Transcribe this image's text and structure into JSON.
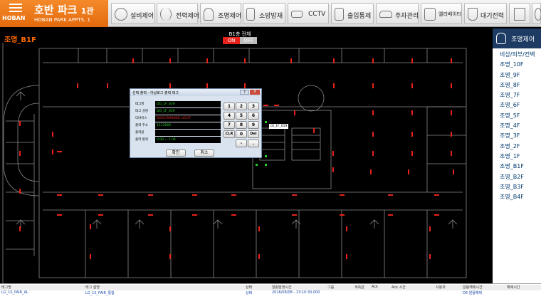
{
  "brand": {
    "logo_text": "HOBAN",
    "title": "호반 파크",
    "title_suffix": "1관",
    "subtitle": "HOBAN PARK APPTS. 1"
  },
  "nav": [
    {
      "label": "설비제어",
      "icon": "fan-icon"
    },
    {
      "label": "전력제어",
      "icon": "antenna-icon"
    },
    {
      "label": "조명제어",
      "icon": "lightbulb-icon"
    },
    {
      "label": "소방방재",
      "icon": "fire-extinguisher-icon"
    },
    {
      "label": "CCTV",
      "icon": "cctv-icon"
    },
    {
      "label": "출입통제",
      "icon": "door-icon"
    },
    {
      "label": "주차관리",
      "icon": "car-icon"
    },
    {
      "label": "엘리베이터",
      "icon": "elevator-icon"
    },
    {
      "label": "대기전력",
      "icon": "plug-icon"
    },
    {
      "label": "",
      "icon": "home-icon"
    },
    {
      "label": "",
      "icon": "settings-icon"
    }
  ],
  "main": {
    "floor_label": "조명_B1F",
    "all_switch": {
      "title": "B1층 전체",
      "on": "ON",
      "off": "OFF"
    }
  },
  "right_panel": {
    "title": "조명제어",
    "items": [
      "비상/외부/컨벡",
      "조명_10F",
      "조명_9F",
      "조명_8F",
      "조명_7F",
      "조명_6F",
      "조명_5F",
      "조명_4F",
      "조명_3F",
      "조명_2F",
      "조명_1F",
      "조명_B1F",
      "조명_B2F",
      "조명_B3F",
      "조명_B4F"
    ]
  },
  "dialog": {
    "title": "선택 출력 - 아날로그 출력 태그",
    "close": "X",
    "help": "?",
    "fields": [
      {
        "key": "태그명",
        "value": "DO_1F_019",
        "color": "green"
      },
      {
        "key": "태그 설명",
        "value": "DO_1F_019",
        "color": "green"
      },
      {
        "key": "디바이스",
        "value": "DOIG:PARKING LIGHT",
        "color": "red"
      },
      {
        "key": "출력 주소",
        "value": "1113003",
        "color": "green"
      },
      {
        "key": "출력값",
        "value": "",
        "color": "green"
      },
      {
        "key": "출력 범위",
        "value": "0.00 ~ 1.00",
        "color": "green"
      }
    ],
    "ok": "확인",
    "cancel": "취소",
    "keys": [
      "1",
      "2",
      "3",
      "4",
      "5",
      "6",
      "7",
      "8",
      "9",
      "CLR",
      "0",
      "Del",
      "-",
      "."
    ]
  },
  "tag_label": "DI_1F_019",
  "bottom_table": {
    "headers": [
      "태그명",
      "태그 설명",
      "상태",
      "알람발생시간",
      "그룹",
      "계측값",
      "Ack",
      "Ack 시간",
      "사용자",
      "알람해제시간",
      "해제시간"
    ],
    "row": [
      "LG_1S_PAIR_AL",
      "LG_1S_PAIR_통합",
      "상태",
      "2016/08/08 - 13:10:30.000",
      "",
      "",
      "",
      "",
      "",
      "D6 알람해제",
      ""
    ]
  },
  "colors": {
    "accent": "#e36a0c",
    "panel_head": "#1d3b63",
    "light_off": "#e8211a",
    "light_on": "#2bd12b"
  }
}
